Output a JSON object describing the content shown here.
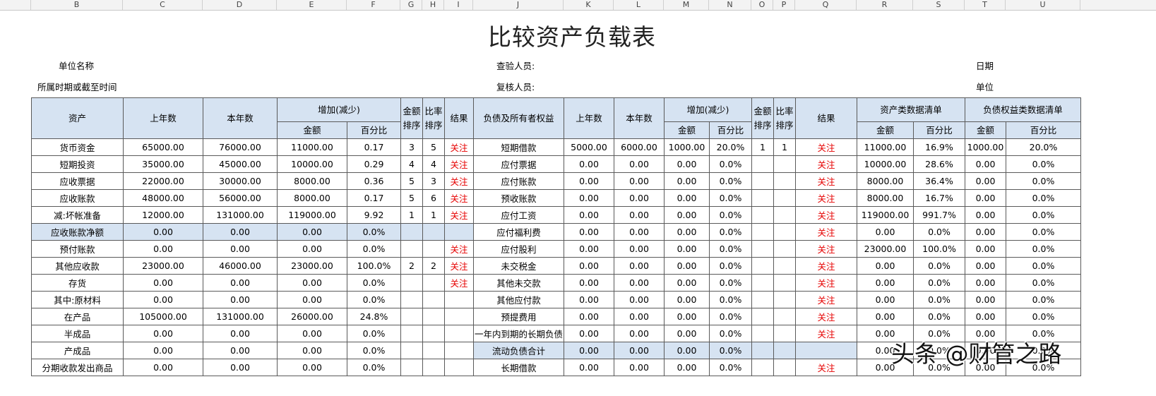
{
  "column_letters": [
    "B",
    "C",
    "D",
    "E",
    "F",
    "G",
    "H",
    "I",
    "J",
    "K",
    "L",
    "M",
    "N",
    "O",
    "P",
    "Q",
    "R",
    "S",
    "T",
    "U"
  ],
  "sheet": {
    "title": "比较资产负载表",
    "info": {
      "unit_name": "单位名称",
      "period": "所属时期或截至时间",
      "inspector": "查验人员:",
      "reviewer": "复核人员:",
      "date": "日期",
      "unit": "单位"
    }
  },
  "table": {
    "headers": {
      "asset": "资产",
      "prev_year": "上年数",
      "this_year": "本年数",
      "change": "增加(减少)",
      "amount": "金额",
      "percent": "百分比",
      "amount_rank": "金额排序",
      "ratio_rank": "比率排序",
      "result": "结果",
      "liability": "负债及所有者权益",
      "prev_year_2": "上年数",
      "this_year_2": "本年数",
      "change_2": "增加(减少)",
      "amount_2": "金额",
      "percent_2": "百分比",
      "amount_rank_2": "金额排序",
      "ratio_rank_2": "比率排序",
      "result_2": "结果",
      "asset_list": "资产类数据清单",
      "liability_list": "负债权益类数据清单",
      "list_amount": "金额",
      "list_percent": "百分比",
      "list_amount_2": "金额",
      "list_percent_2": "百分比"
    },
    "rows": [
      [
        "货币资金",
        "65000.00",
        "76000.00",
        "11000.00",
        "0.17",
        "3",
        "5",
        "关注",
        "短期借款",
        "5000.00",
        "6000.00",
        "1000.00",
        "20.0%",
        "1",
        "1",
        "关注",
        "11000.00",
        "16.9%",
        "1000.00",
        "20.0%"
      ],
      [
        "短期投资",
        "35000.00",
        "45000.00",
        "10000.00",
        "0.29",
        "4",
        "4",
        "关注",
        "应付票据",
        "0.00",
        "0.00",
        "0.00",
        "0.0%",
        "",
        "",
        "关注",
        "10000.00",
        "28.6%",
        "0.00",
        "0.0%"
      ],
      [
        "应收票据",
        "22000.00",
        "30000.00",
        "8000.00",
        "0.36",
        "5",
        "3",
        "关注",
        "应付账款",
        "0.00",
        "0.00",
        "0.00",
        "0.0%",
        "",
        "",
        "关注",
        "8000.00",
        "36.4%",
        "0.00",
        "0.0%"
      ],
      [
        "应收账款",
        "48000.00",
        "56000.00",
        "8000.00",
        "0.17",
        "5",
        "6",
        "关注",
        "预收账款",
        "0.00",
        "0.00",
        "0.00",
        "0.0%",
        "",
        "",
        "关注",
        "8000.00",
        "16.7%",
        "0.00",
        "0.0%"
      ],
      [
        "减:坏帐准备",
        "12000.00",
        "131000.00",
        "119000.00",
        "9.92",
        "1",
        "1",
        "关注",
        "应付工资",
        "0.00",
        "0.00",
        "0.00",
        "0.0%",
        "",
        "",
        "关注",
        "119000.00",
        "991.7%",
        "0.00",
        "0.0%"
      ],
      [
        "应收账款净额",
        "0.00",
        "0.00",
        "0.00",
        "0.0%",
        "",
        "",
        "",
        "应付福利费",
        "0.00",
        "0.00",
        "0.00",
        "0.0%",
        "",
        "",
        "关注",
        "0.00",
        "0.0%",
        "0.00",
        "0.0%"
      ],
      [
        "预付账款",
        "0.00",
        "0.00",
        "0.00",
        "0.0%",
        "",
        "",
        "关注",
        "应付股利",
        "0.00",
        "0.00",
        "0.00",
        "0.0%",
        "",
        "",
        "关注",
        "23000.00",
        "100.0%",
        "0.00",
        "0.0%"
      ],
      [
        "其他应收款",
        "23000.00",
        "46000.00",
        "23000.00",
        "100.0%",
        "2",
        "2",
        "关注",
        "未交税金",
        "0.00",
        "0.00",
        "0.00",
        "0.0%",
        "",
        "",
        "关注",
        "0.00",
        "0.0%",
        "0.00",
        "0.0%"
      ],
      [
        "存货",
        "0.00",
        "0.00",
        "0.00",
        "0.0%",
        "",
        "",
        "关注",
        "其他未交款",
        "0.00",
        "0.00",
        "0.00",
        "0.0%",
        "",
        "",
        "关注",
        "0.00",
        "0.0%",
        "0.00",
        "0.0%"
      ],
      [
        "其中:原材料",
        "0.00",
        "0.00",
        "0.00",
        "0.0%",
        "",
        "",
        "",
        "其他应付款",
        "0.00",
        "0.00",
        "0.00",
        "0.0%",
        "",
        "",
        "关注",
        "0.00",
        "0.0%",
        "0.00",
        "0.0%"
      ],
      [
        "在产品",
        "105000.00",
        "131000.00",
        "26000.00",
        "24.8%",
        "",
        "",
        "",
        "预提费用",
        "0.00",
        "0.00",
        "0.00",
        "0.0%",
        "",
        "",
        "关注",
        "0.00",
        "0.0%",
        "0.00",
        "0.0%"
      ],
      [
        "半成品",
        "0.00",
        "0.00",
        "0.00",
        "0.0%",
        "",
        "",
        "",
        "一年内到期的长期负债",
        "0.00",
        "0.00",
        "0.00",
        "0.0%",
        "",
        "",
        "关注",
        "0.00",
        "0.0%",
        "0.00",
        "0.0%"
      ],
      [
        "产成品",
        "0.00",
        "0.00",
        "0.00",
        "0.0%",
        "",
        "",
        "",
        "流动负债合计",
        "0.00",
        "0.00",
        "0.00",
        "0.0%",
        "",
        "",
        "",
        "0.00",
        "0.0%",
        "0.00",
        "0.0%"
      ],
      [
        "分期收款发出商品",
        "0.00",
        "0.00",
        "0.00",
        "0.0%",
        "",
        "",
        "",
        "长期借款",
        "0.00",
        "0.00",
        "0.00",
        "0.0%",
        "",
        "",
        "关注",
        "0.00",
        "0.0%",
        "0.00",
        "0.0%"
      ]
    ]
  },
  "watermark": "头条 @财管之路",
  "colors": {
    "header_fill": "#d6e3f2",
    "alert_text": "#e60000",
    "grid_line": "#5a5a5a"
  }
}
